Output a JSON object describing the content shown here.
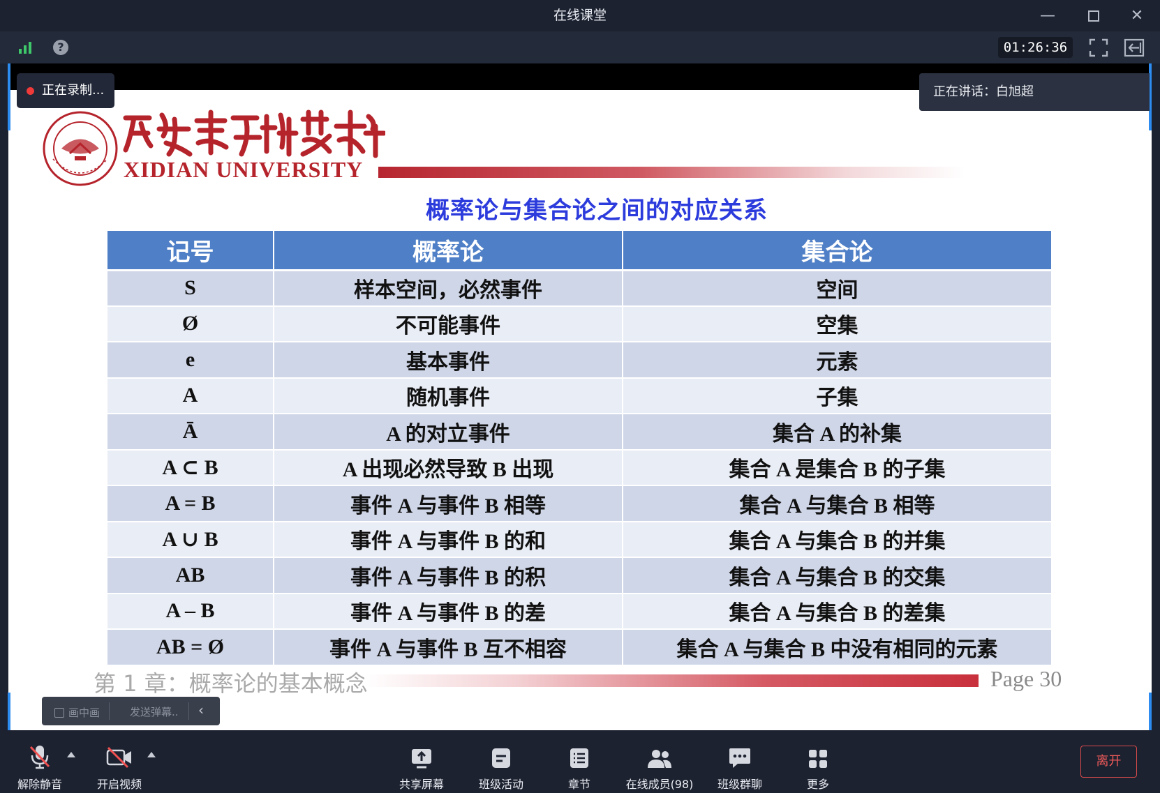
{
  "window": {
    "title": "在线课堂"
  },
  "toolbar": {
    "timer": "01:26:36"
  },
  "overlay": {
    "recording": "正在录制...",
    "speaking": "正在讲话：白旭超"
  },
  "slide": {
    "university_en": "XIDIAN UNIVERSITY",
    "title": "概率论与集合论之间的对应关系",
    "headers": [
      "记号",
      "概率论",
      "集合论"
    ],
    "rows": [
      [
        "S",
        "样本空间，必然事件",
        "空间"
      ],
      [
        "Ø",
        "不可能事件",
        "空集"
      ],
      [
        "e",
        "基本事件",
        "元素"
      ],
      [
        "A",
        "随机事件",
        "子集"
      ],
      [
        "Ā",
        "A 的对立事件",
        "集合 A 的补集"
      ],
      [
        "A ⊂ B",
        "A 出现必然导致 B 出现",
        "集合 A 是集合 B 的子集"
      ],
      [
        "A = B",
        "事件 A 与事件 B 相等",
        "集合 A 与集合 B 相等"
      ],
      [
        "A ∪ B",
        "事件 A 与事件 B 的和",
        "集合 A 与集合 B 的并集"
      ],
      [
        "AB",
        "事件 A 与事件 B 的积",
        "集合 A 与集合 B 的交集"
      ],
      [
        "A – B",
        "事件 A 与事件 B 的差",
        "集合 A 与集合 B 的差集"
      ],
      [
        "AB = Ø",
        "事件 A 与事件 B 互不相容",
        "集合 A 与集合 B 中没有相同的元素"
      ]
    ],
    "chapter": "第 1 章：概率论的基本概念",
    "page": "Page  30"
  },
  "pip_bar": {
    "pip_label": "画中画",
    "danmu_placeholder": "发送弹幕..",
    "collapse": "‹"
  },
  "bottom": {
    "unmute": "解除静音",
    "video": "开启视频",
    "share": "共享屏幕",
    "activity": "班级活动",
    "chapter": "章节",
    "members": "在线成员(98)",
    "chat": "班级群聊",
    "more": "更多",
    "leave": "离开"
  },
  "colors": {
    "accent_blue": "#2c3bdc",
    "table_header": "#4f7fc6",
    "brand_red": "#b5232b",
    "leave_red": "#f05a5a"
  }
}
